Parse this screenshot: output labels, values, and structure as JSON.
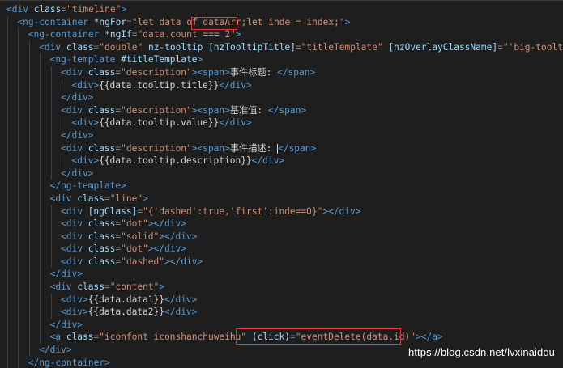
{
  "editor": {
    "lines": [
      {
        "indent": 0,
        "tokens": [
          [
            "tag",
            "<div "
          ],
          [
            "attr",
            "class"
          ],
          [
            "punct",
            "="
          ],
          [
            "str",
            "\"timeline\""
          ],
          [
            "tag",
            ">"
          ]
        ]
      },
      {
        "indent": 1,
        "tokens": [
          [
            "tag",
            "<ng-container "
          ],
          [
            "attr",
            "*ngFor"
          ],
          [
            "punct",
            "="
          ],
          [
            "str",
            "\"let data of "
          ],
          [
            "str",
            "dataArr;"
          ],
          [
            "str",
            "let inde = index;\""
          ],
          [
            "tag",
            ">"
          ]
        ]
      },
      {
        "indent": 2,
        "tokens": [
          [
            "tag",
            "<ng-container "
          ],
          [
            "attr",
            "*ngIf"
          ],
          [
            "punct",
            "="
          ],
          [
            "str",
            "\"data.count === 2\""
          ],
          [
            "tag",
            ">"
          ]
        ]
      },
      {
        "indent": 3,
        "tokens": [
          [
            "tag",
            "<div "
          ],
          [
            "attr",
            "class"
          ],
          [
            "punct",
            "="
          ],
          [
            "str",
            "\"double\""
          ],
          [
            "text",
            " "
          ],
          [
            "attr",
            "nz-tooltip"
          ],
          [
            "text",
            " "
          ],
          [
            "attr",
            "[nzTooltipTitle]"
          ],
          [
            "punct",
            "="
          ],
          [
            "str",
            "\"titleTemplate\""
          ],
          [
            "text",
            " "
          ],
          [
            "attr",
            "[nzOverlayClassName]"
          ],
          [
            "punct",
            "="
          ],
          [
            "str",
            "\"'big-tooltip'\""
          ],
          [
            "tag",
            ">"
          ]
        ]
      },
      {
        "indent": 4,
        "tokens": [
          [
            "tag",
            "<ng-template "
          ],
          [
            "attr",
            "#titleTemplate"
          ],
          [
            "tag",
            ">"
          ]
        ]
      },
      {
        "indent": 5,
        "tokens": [
          [
            "tag",
            "<div "
          ],
          [
            "attr",
            "class"
          ],
          [
            "punct",
            "="
          ],
          [
            "str",
            "\"description\""
          ],
          [
            "tag",
            ">"
          ],
          [
            "tag",
            "<span>"
          ],
          [
            "text",
            "事件标题: "
          ],
          [
            "tag",
            "</span>"
          ]
        ]
      },
      {
        "indent": 6,
        "tokens": [
          [
            "tag",
            "<div>"
          ],
          [
            "text",
            "{{data.tooltip.title}}"
          ],
          [
            "tag",
            "</div>"
          ]
        ]
      },
      {
        "indent": 5,
        "tokens": [
          [
            "tag",
            "</div>"
          ]
        ]
      },
      {
        "indent": 5,
        "tokens": [
          [
            "tag",
            "<div "
          ],
          [
            "attr",
            "class"
          ],
          [
            "punct",
            "="
          ],
          [
            "str",
            "\"description\""
          ],
          [
            "tag",
            ">"
          ],
          [
            "tag",
            "<span>"
          ],
          [
            "text",
            "基准值: "
          ],
          [
            "tag",
            "</span>"
          ]
        ]
      },
      {
        "indent": 6,
        "tokens": [
          [
            "tag",
            "<div>"
          ],
          [
            "text",
            "{{data.tooltip.value}}"
          ],
          [
            "tag",
            "</div>"
          ]
        ]
      },
      {
        "indent": 5,
        "tokens": [
          [
            "tag",
            "</div>"
          ]
        ]
      },
      {
        "indent": 5,
        "tokens": [
          [
            "tag",
            "<div "
          ],
          [
            "attr",
            "class"
          ],
          [
            "punct",
            "="
          ],
          [
            "str",
            "\"description\""
          ],
          [
            "tag",
            ">"
          ],
          [
            "tag",
            "<span>"
          ],
          [
            "text",
            "事件描述: "
          ],
          [
            "cursor",
            ""
          ],
          [
            "tag",
            "</span>"
          ]
        ]
      },
      {
        "indent": 6,
        "tokens": [
          [
            "tag",
            "<div>"
          ],
          [
            "text",
            "{{data.tooltip.description}}"
          ],
          [
            "tag",
            "</div>"
          ]
        ]
      },
      {
        "indent": 5,
        "tokens": [
          [
            "tag",
            "</div>"
          ]
        ]
      },
      {
        "indent": 4,
        "tokens": [
          [
            "tag",
            "</ng-template>"
          ]
        ]
      },
      {
        "indent": 4,
        "tokens": [
          [
            "tag",
            "<div "
          ],
          [
            "attr",
            "class"
          ],
          [
            "punct",
            "="
          ],
          [
            "str",
            "\"line\""
          ],
          [
            "tag",
            ">"
          ]
        ]
      },
      {
        "indent": 5,
        "tokens": [
          [
            "tag",
            "<div "
          ],
          [
            "attr",
            "[ngClass]"
          ],
          [
            "punct",
            "="
          ],
          [
            "str",
            "\"{'dashed':true,'first':inde==0}\""
          ],
          [
            "tag",
            "></div>"
          ]
        ]
      },
      {
        "indent": 5,
        "tokens": [
          [
            "tag",
            "<div "
          ],
          [
            "attr",
            "class"
          ],
          [
            "punct",
            "="
          ],
          [
            "str",
            "\"dot\""
          ],
          [
            "tag",
            "></div>"
          ]
        ]
      },
      {
        "indent": 5,
        "tokens": [
          [
            "tag",
            "<div "
          ],
          [
            "attr",
            "class"
          ],
          [
            "punct",
            "="
          ],
          [
            "str",
            "\"solid\""
          ],
          [
            "tag",
            "></div>"
          ]
        ]
      },
      {
        "indent": 5,
        "tokens": [
          [
            "tag",
            "<div "
          ],
          [
            "attr",
            "class"
          ],
          [
            "punct",
            "="
          ],
          [
            "str",
            "\"dot\""
          ],
          [
            "tag",
            "></div>"
          ]
        ]
      },
      {
        "indent": 5,
        "tokens": [
          [
            "tag",
            "<div "
          ],
          [
            "attr",
            "class"
          ],
          [
            "punct",
            "="
          ],
          [
            "str",
            "\"dashed\""
          ],
          [
            "tag",
            "></div>"
          ]
        ]
      },
      {
        "indent": 4,
        "tokens": [
          [
            "tag",
            "</div>"
          ]
        ]
      },
      {
        "indent": 4,
        "tokens": [
          [
            "tag",
            "<div "
          ],
          [
            "attr",
            "class"
          ],
          [
            "punct",
            "="
          ],
          [
            "str",
            "\"content\""
          ],
          [
            "tag",
            ">"
          ]
        ]
      },
      {
        "indent": 5,
        "tokens": [
          [
            "tag",
            "<div>"
          ],
          [
            "text",
            "{{data.data1}}"
          ],
          [
            "tag",
            "</div>"
          ]
        ]
      },
      {
        "indent": 5,
        "tokens": [
          [
            "tag",
            "<div>"
          ],
          [
            "text",
            "{{data.data2}}"
          ],
          [
            "tag",
            "</div>"
          ]
        ]
      },
      {
        "indent": 4,
        "tokens": [
          [
            "tag",
            "</div>"
          ]
        ]
      },
      {
        "indent": 4,
        "tokens": [
          [
            "tag",
            "<a "
          ],
          [
            "attr",
            "class"
          ],
          [
            "punct",
            "="
          ],
          [
            "str",
            "\"iconfont iconshanchuweihu\""
          ],
          [
            "text",
            " "
          ],
          [
            "attr",
            "(click)"
          ],
          [
            "punct",
            "="
          ],
          [
            "str",
            "\"eventDelete(data.id)\""
          ],
          [
            "tag",
            ">"
          ],
          [
            "tag",
            "</a>"
          ]
        ]
      },
      {
        "indent": 3,
        "tokens": [
          [
            "tag",
            "</div>"
          ]
        ]
      },
      {
        "indent": 2,
        "tokens": [
          [
            "tag",
            "</ng-container>"
          ]
        ]
      }
    ]
  },
  "watermark": "https://blog.csdn.net/lvxinaidou",
  "colors": {
    "background": "#1e1e1e",
    "tag": "#569cd6",
    "attribute": "#9cdcfe",
    "string": "#ce9178",
    "text": "#d4d4d4",
    "highlight": "#e03a3a"
  }
}
